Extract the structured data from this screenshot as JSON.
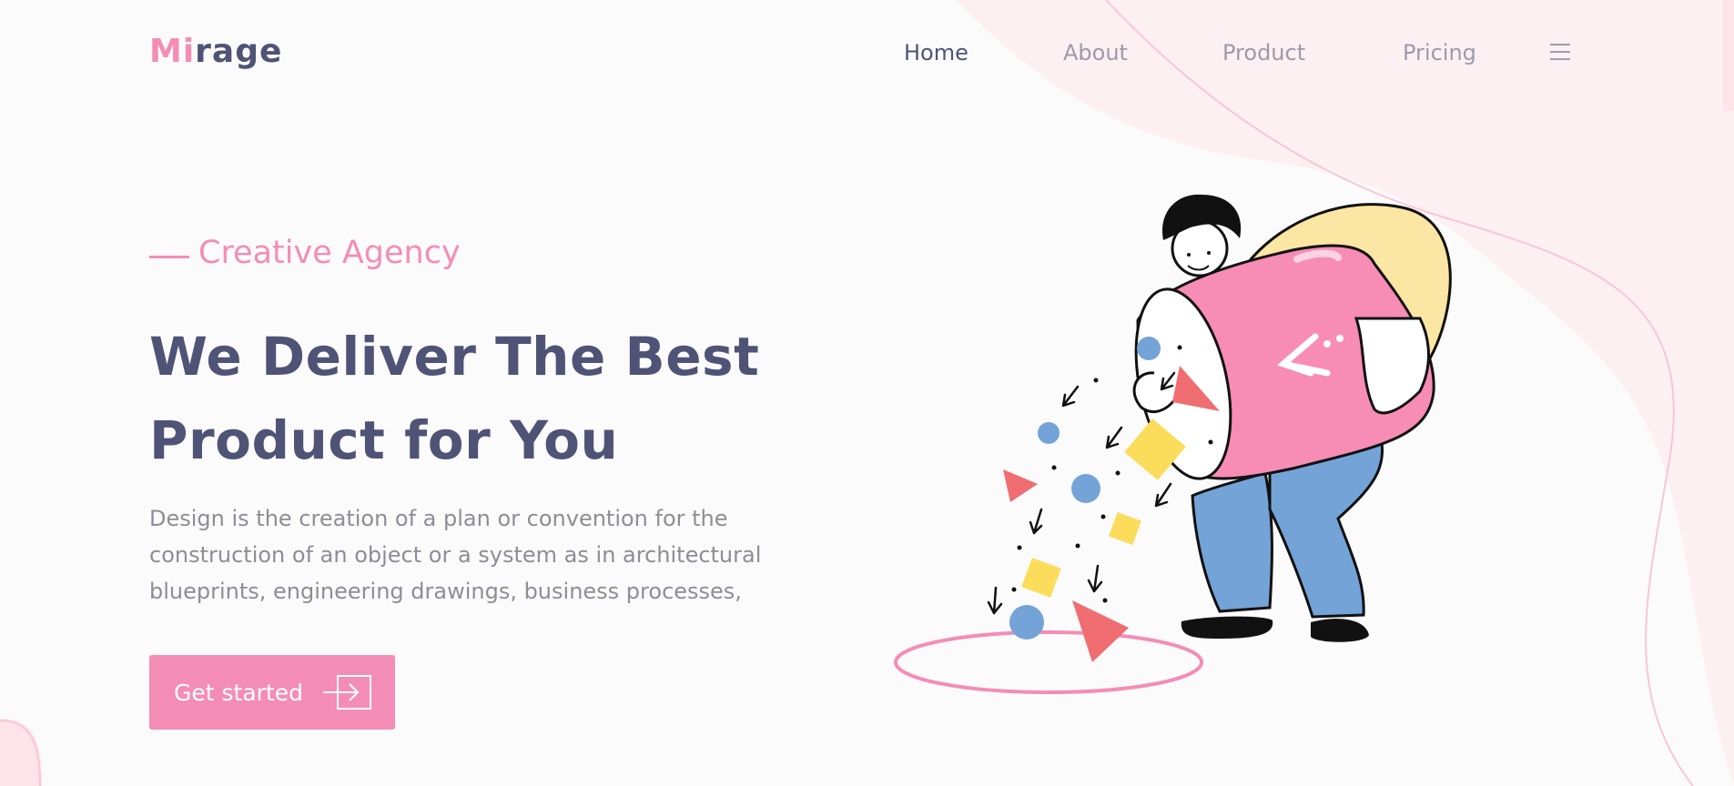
{
  "brand": {
    "logo_prefix": "Mi",
    "logo_suffix": "rage",
    "accent_color": "#f48db5",
    "text_color": "#4f5376"
  },
  "nav": {
    "items": [
      {
        "label": "Home",
        "active": true
      },
      {
        "label": "About",
        "active": false
      },
      {
        "label": "Product",
        "active": false
      },
      {
        "label": "Pricing",
        "active": false
      }
    ],
    "menu_icon": "hamburger-icon"
  },
  "hero": {
    "eyebrow": "Creative Agency",
    "headline_line1": "We Deliver The Best",
    "headline_line2": "Product for You",
    "description": "Design is the creation of a plan or convention for the construction of an object or a system as in architectural blueprints, engineering drawings, business processes,",
    "cta_label": "Get started",
    "cta_icon": "arrow-right-icon"
  },
  "illustration": {
    "name": "person-pouring-shapes-illustration"
  }
}
